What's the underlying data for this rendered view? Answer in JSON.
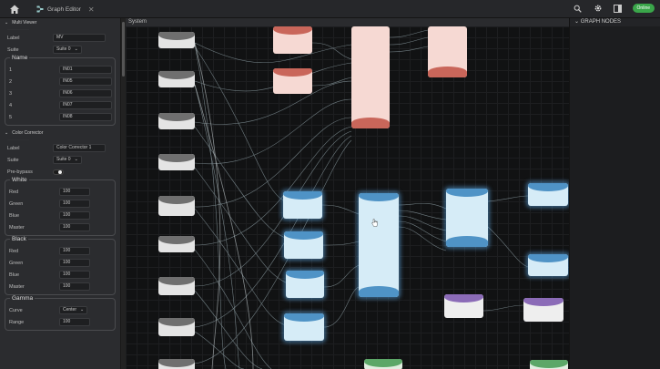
{
  "topbar": {
    "tab_title": "Graph Editor",
    "tab_close": "✕",
    "status_pill": "Online"
  },
  "left": {
    "multiviewer": {
      "section": "Multi Viewer",
      "hint": "……………………",
      "label_caption": "Label",
      "label_value": "MV",
      "suite_caption": "Suite",
      "suite_value": "Suite 0",
      "name_group": "Name",
      "names": [
        {
          "idx": "1",
          "value": "IN01"
        },
        {
          "idx": "2",
          "value": "IN05"
        },
        {
          "idx": "3",
          "value": "IN06"
        },
        {
          "idx": "4",
          "value": "IN07"
        },
        {
          "idx": "5",
          "value": "IN08"
        }
      ]
    },
    "colorcorrector": {
      "section": "Color Corrector",
      "label_caption": "Label",
      "label_value": "Color Corrector 1",
      "suite_caption": "Suite",
      "suite_value": "Suite 0",
      "bypass_caption": "Pre-bypass",
      "white": {
        "title": "White",
        "rows": [
          {
            "label": "Red",
            "value": "100"
          },
          {
            "label": "Green",
            "value": "100"
          },
          {
            "label": "Blue",
            "value": "100"
          },
          {
            "label": "Master",
            "value": "100"
          }
        ]
      },
      "black": {
        "title": "Black",
        "rows": [
          {
            "label": "Red",
            "value": "100"
          },
          {
            "label": "Green",
            "value": "100"
          },
          {
            "label": "Blue",
            "value": "100"
          },
          {
            "label": "Master",
            "value": "100"
          }
        ]
      },
      "gamma": {
        "title": "Gamma",
        "curve_caption": "Curve",
        "curve_value": "Center",
        "range_caption": "Range",
        "range_value": "100"
      }
    }
  },
  "canvas": {
    "header": "System"
  },
  "right": {
    "header": "GRAPH NODES"
  },
  "colors": {
    "accent_blue": "#4f93c6",
    "node_red": "#c9665a",
    "node_purple": "#8b6bb7",
    "node_green": "#5ca768",
    "status_green": "#3aa64a"
  }
}
